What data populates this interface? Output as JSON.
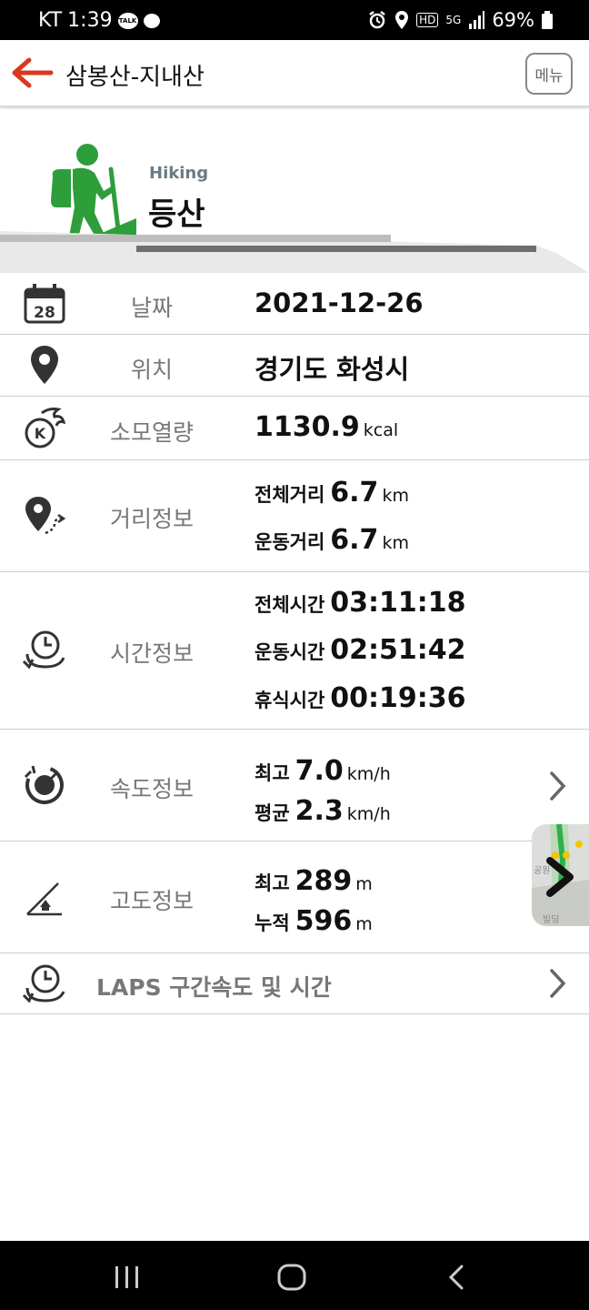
{
  "status_bar": {
    "carrier": "KT",
    "time": "1:39",
    "talk_badge": "TALK",
    "hd_label": "HD",
    "network": "5G",
    "battery": "69%"
  },
  "header": {
    "title": "삼봉산-지내산",
    "menu_label": "메뉴"
  },
  "activity": {
    "en": "Hiking",
    "ko": "등산",
    "accent_color": "#2e9e3a"
  },
  "date": {
    "icon_day": "28",
    "label": "날짜",
    "value": "2021-12-26"
  },
  "location": {
    "label": "위치",
    "value": "경기도 화성시"
  },
  "calories": {
    "label": "소모열량",
    "value": "1130.9",
    "unit": "kcal",
    "icon_letter": "K"
  },
  "distance": {
    "label": "거리정보",
    "lines": [
      {
        "label": "전체거리",
        "value": "6.7",
        "unit": "km"
      },
      {
        "label": "운동거리",
        "value": "6.7",
        "unit": "km"
      }
    ]
  },
  "time_info": {
    "label": "시간정보",
    "lines": [
      {
        "label": "전체시간",
        "value": "03:11:18"
      },
      {
        "label": "운동시간",
        "value": "02:51:42"
      },
      {
        "label": "휴식시간",
        "value": "00:19:36"
      }
    ]
  },
  "speed": {
    "label": "속도정보",
    "lines": [
      {
        "label": "최고",
        "value": "7.0",
        "unit": "km/h"
      },
      {
        "label": "평균",
        "value": "2.3",
        "unit": "km/h"
      }
    ]
  },
  "altitude": {
    "label": "고도정보",
    "lines": [
      {
        "label": "최고",
        "value": "289",
        "unit": "m"
      },
      {
        "label": "누적",
        "value": "596",
        "unit": "m"
      }
    ]
  },
  "laps": {
    "label": "LAPS 구간속도 및 시간"
  },
  "map_thumb": {
    "labels": [
      "공원",
      "빌딩"
    ]
  },
  "icons": {
    "back": "back-arrow-icon",
    "calendar": "calendar-icon",
    "location": "location-pin-icon",
    "calories": "calorie-flame-icon",
    "distance": "distance-route-icon",
    "time": "clock-history-icon",
    "speed": "speedometer-icon",
    "altitude": "altitude-slope-icon",
    "laps": "laps-clock-icon",
    "chevron": "chevron-right-icon"
  }
}
